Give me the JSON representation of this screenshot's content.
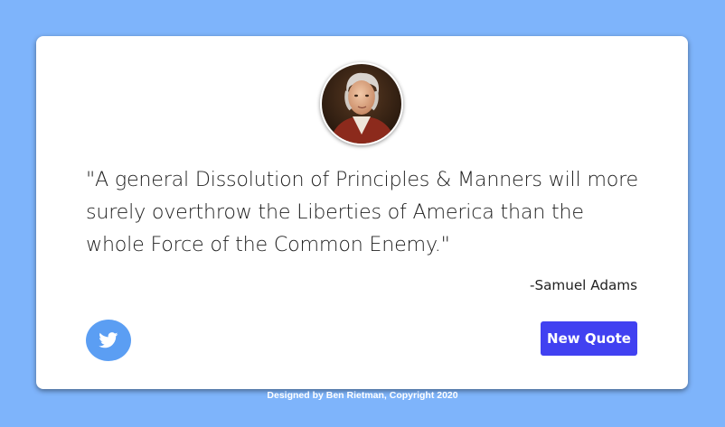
{
  "colors": {
    "background": "#7eb4fb",
    "card": "#ffffff",
    "twitter_button": "#5b9ef3",
    "new_quote_button": "#4141f1",
    "text": "#222222"
  },
  "portrait": {
    "icon": "samuel-adams-portrait"
  },
  "quote": {
    "text": "\"A general Dissolution of Principles & Manners will more surely overthrow the Liberties of America than the whole Force of the Common Enemy.\"",
    "author": "-Samuel Adams"
  },
  "buttons": {
    "tweet_icon": "twitter-icon",
    "new_quote_label": "New Quote"
  },
  "footer": {
    "text": "Designed by Ben Rietman, Copyright 2020"
  }
}
